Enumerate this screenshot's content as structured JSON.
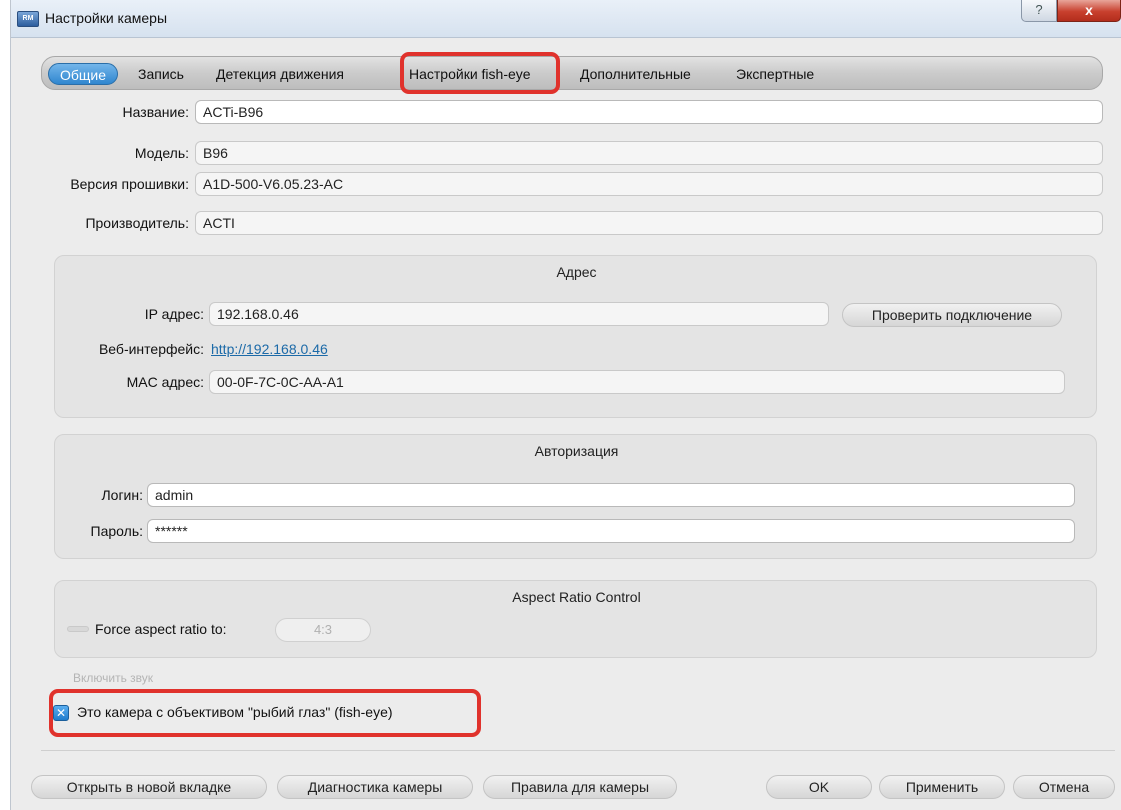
{
  "window": {
    "title": "Настройки камеры",
    "icon_label": "RM",
    "help_label": "?",
    "close_label": "x"
  },
  "tabs": [
    {
      "label": "Общие",
      "active": true
    },
    {
      "label": "Запись"
    },
    {
      "label": "Детекция движения"
    },
    {
      "label": "Настройки fish-eye",
      "highlighted": true
    },
    {
      "label": "Дополнительные"
    },
    {
      "label": "Экспертные"
    }
  ],
  "general": {
    "name_label": "Название:",
    "name_value": "ACTi-B96",
    "model_label": "Модель:",
    "model_value": "B96",
    "firmware_label": "Версия прошивки:",
    "firmware_value": "A1D-500-V6.05.23-AC",
    "vendor_label": "Производитель:",
    "vendor_value": "ACTI"
  },
  "address": {
    "title": "Адрес",
    "ip_label": "IP адрес:",
    "ip_value": "192.168.0.46",
    "check_button": "Проверить подключение",
    "web_label": "Веб-интерфейс:",
    "web_link": "http://192.168.0.46",
    "mac_label": "MAC адрес:",
    "mac_value": "00-0F-7C-0C-AA-A1"
  },
  "auth": {
    "title": "Авторизация",
    "login_label": "Логин:",
    "login_value": "admin",
    "password_label": "Пароль:",
    "password_value": "******"
  },
  "aspect": {
    "title": "Aspect Ratio Control",
    "force_label": "Force aspect ratio to:",
    "ratio_value": "4:3"
  },
  "audio": {
    "label": "Включить звук"
  },
  "fisheye": {
    "label": "Это камера с объективом \"рыбий глаз\" (fish-eye)",
    "checked": true,
    "check_glyph": "✕"
  },
  "buttons": {
    "open_new_tab": "Открыть в новой вкладке",
    "diagnostics": "Диагностика камеры",
    "rules": "Правила для камеры",
    "ok": "OK",
    "apply": "Применить",
    "cancel": "Отмена"
  },
  "colors": {
    "accent": "#2f86cf",
    "highlight_border": "#e0322c",
    "link": "#1c6aa8"
  }
}
